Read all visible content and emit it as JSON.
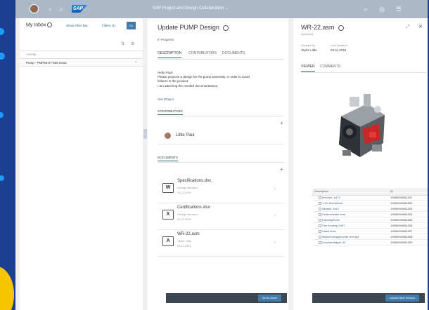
{
  "shell": {
    "title": "SAP Project and Design Collaboration",
    "logo": "SAP"
  },
  "inbox": {
    "title": "My Inbox",
    "show_filter": "Show Filter Bar",
    "filters": "Filters (1)",
    "go": "Go",
    "activity_header": "Activity",
    "items": [
      {
        "label": "Pump : PMP65-67-836 Issue"
      }
    ]
  },
  "detail": {
    "title": "Update PUMP Design",
    "status": "In Progress",
    "tabs": [
      "DESCRIPTION",
      "CONTRIBUTORS",
      "DOCUMENTS"
    ],
    "body_lines": [
      "Hello Paul!",
      "Please propose a design for the pump assembly, in order to avoid",
      "failures in the product.",
      "I am attaching the needed documentations."
    ],
    "see_project": "See Project",
    "contributors_header": "CONTRIBUTORS",
    "contributor": "Little Paul",
    "documents_header": "DOCUMENTS",
    "documents": [
      {
        "name": "Specifications.doc",
        "author": "George Bernard",
        "date": "03.11.2015",
        "icon": "W"
      },
      {
        "name": "Certifications.xlsx",
        "author": "George Bernard",
        "date": "03.11.2015",
        "icon": "X"
      },
      {
        "name": "WR-22.asm",
        "author": "Taylor Little",
        "date": "03.11.2015",
        "icon": "A"
      }
    ],
    "footer_button": "Set to Done"
  },
  "viewer": {
    "title": "WR-22.asm",
    "subtitle": "Assembly",
    "created_by_label": "Created By",
    "created_by": "Taylor Little",
    "updated_label": "Last Updated",
    "updated": "03.11.2015",
    "tabs": [
      "VIEWER",
      "COMMENTS"
    ],
    "table_headers": [
      "Description",
      "ID"
    ],
    "parts": [
      {
        "desc": "inventor_w171",
        "id": "10000000004321"
      },
      {
        "desc": "1-2V-Stecktdose",
        "id": "10000000004322"
      },
      {
        "desc": "Blindkk. 3x10",
        "id": "10000000004323"
      },
      {
        "desc": "Federscheibe vers.",
        "id": "10000000004324"
      },
      {
        "desc": "Fischtopfhoim",
        "id": "10000000004325"
      },
      {
        "desc": "Fan housing X457",
        "id": "10000000004326"
      },
      {
        "desc": "Kabel links",
        "id": "10000000004327"
      },
      {
        "desc": "Beleuchtungsleuchte vers kpl",
        "id": "10000000004328"
      },
      {
        "desc": "Leuchtenträger U3",
        "id": "10000000004329"
      }
    ],
    "footer_button": "Upload New Version"
  },
  "colors": {
    "shell": "#aab8c8",
    "accent": "#427cac",
    "background": "#1d3f8f"
  }
}
